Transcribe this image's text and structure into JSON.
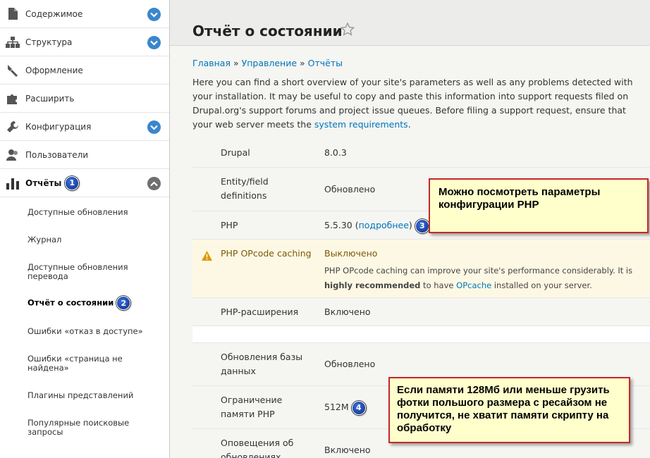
{
  "sidebar": {
    "items": [
      {
        "label": "Содержимое",
        "icon": "content-icon",
        "toggle": "expand"
      },
      {
        "label": "Структура",
        "icon": "structure-icon",
        "toggle": "expand"
      },
      {
        "label": "Оформление",
        "icon": "appearance-icon"
      },
      {
        "label": "Расширить",
        "icon": "extend-icon"
      },
      {
        "label": "Конфигурация",
        "icon": "wrench-icon",
        "toggle": "expand"
      },
      {
        "label": "Пользователи",
        "icon": "users-icon"
      },
      {
        "label": "Отчёты",
        "icon": "reports-icon",
        "toggle": "collapse",
        "badge": "1"
      }
    ],
    "subitems": [
      {
        "label": "Доступные обновления"
      },
      {
        "label": "Журнал"
      },
      {
        "label": "Доступные обновления перевода"
      },
      {
        "label": "Отчёт о состоянии",
        "badge": "2"
      },
      {
        "label": "Ошибки «отказ в доступе»"
      },
      {
        "label": "Ошибки «страница не найдена»"
      },
      {
        "label": "Плагины представлений"
      },
      {
        "label": "Популярные поисковые запросы"
      }
    ]
  },
  "header": {
    "title": "Отчёт о состоянии"
  },
  "breadcrumb": {
    "items": [
      "Главная",
      "Управление",
      "Отчёты"
    ],
    "separator": "»"
  },
  "intro": {
    "text": "Here you can find a short overview of your site's parameters as well as any problems detected with your installation. It may be useful to copy and paste this information into support requests filed on Drupal.org's support forums and project issue queues. Before filing a support request, ensure that your web server meets the ",
    "link": "system requirements",
    "end": "."
  },
  "status": {
    "rows": [
      {
        "title": "Drupal",
        "value": "8.0.3"
      },
      {
        "title": "Entity/field definitions",
        "value": "Обновлено"
      },
      {
        "title": "PHP",
        "value": "5.5.30 (",
        "link": "подробнее",
        "value_end": ")",
        "badge": "3"
      },
      {
        "title": "PHP OPcode caching",
        "value": "Выключено",
        "desc_1": "PHP OPcode caching can improve your site's performance considerably. It is ",
        "desc_strong": "highly recommended",
        "desc_2": " to have ",
        "desc_link": "OPcache",
        "desc_3": " installed on your server."
      },
      {
        "title": "PHP-расширения",
        "value": "Включено"
      },
      {
        "title": "Обновления базы данных",
        "value": "Обновлено"
      },
      {
        "title": "Ограничение памяти PHP",
        "value": "512M",
        "badge": "4"
      },
      {
        "title": "Оповещения об обновлениях",
        "value": "Включено"
      }
    ]
  },
  "callouts": {
    "php": "Можно посмотреть параметры конфигурации PHP",
    "memory": "Если памяти 128Мб или меньше грузить фотки польшого размера с ресайзом не получится, не хватит памяти скрипту на обработку"
  },
  "colors": {
    "link": "#0074bd",
    "toggle": "#3b86cc",
    "warning": "#e29700",
    "callout_border": "#c62828",
    "callout_bg": "#ffffcc"
  }
}
